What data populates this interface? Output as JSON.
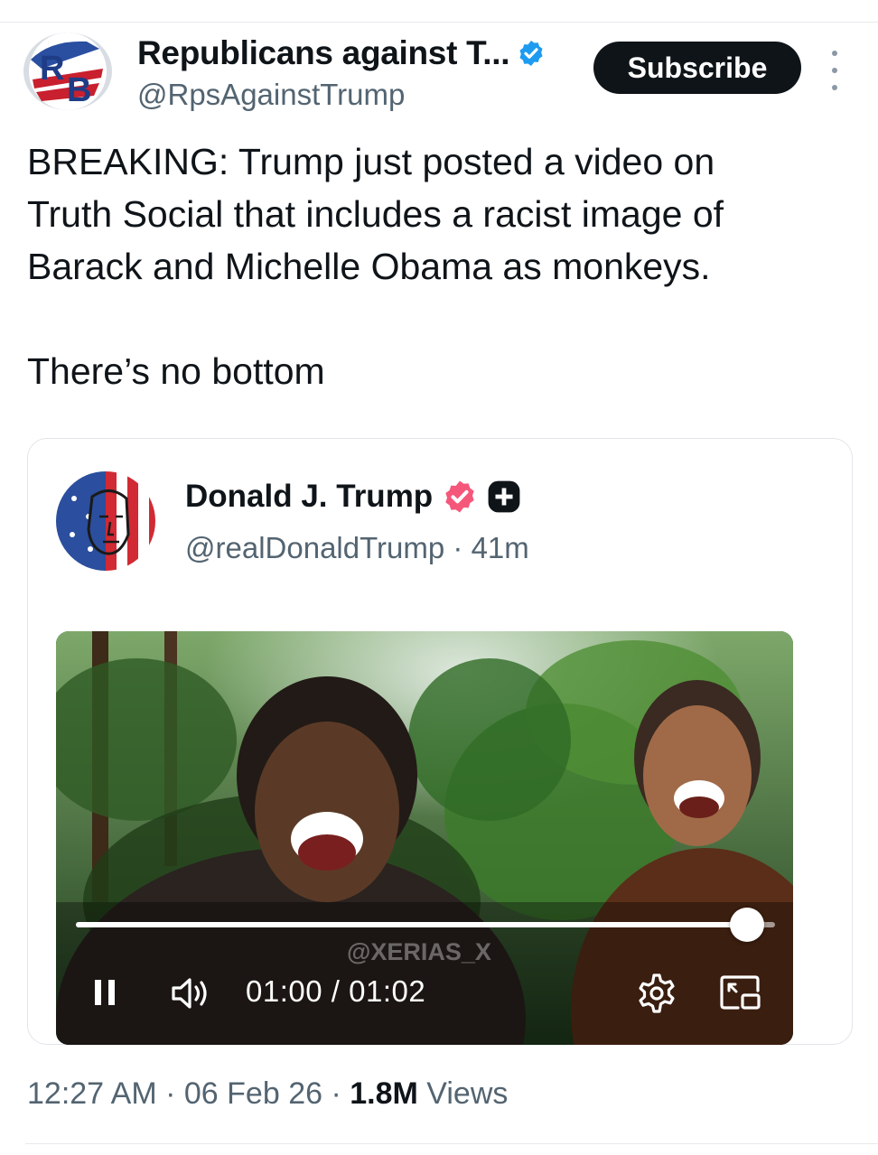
{
  "tweet": {
    "author_name": "Republicans against T...",
    "author_handle": "@RpsAgainstTrump",
    "avatar_text": "RB",
    "subscribe_label": "Subscribe",
    "text_lines": [
      "BREAKING: Trump just posted a video on",
      "Truth Social that includes a racist image of",
      "Barack and Michelle Obama as monkeys."
    ],
    "text_tail": "There’s no bottom",
    "time": "12:27 AM",
    "date": "06 Feb 26",
    "views_count": "1.8M",
    "views_label": "Views",
    "separator": "·"
  },
  "quote": {
    "author_name": "Donald J. Trump",
    "author_handle": "@realDonaldTrump",
    "age": "41m",
    "separator": "·",
    "video": {
      "watermark": "@XERIAS_X",
      "current_time": "01:00",
      "duration": "01:02",
      "time_separator": " / ",
      "progress": 0.96
    }
  },
  "colors": {
    "verified_blue": "#1d9bf0",
    "truth_pink": "#f5577b",
    "subscribe_bg": "#0f1419",
    "muted": "#536471"
  },
  "icons": [
    "verified-badge-icon",
    "truth-verified-badge-icon",
    "plus-icon",
    "more-icon",
    "pause-icon",
    "volume-icon",
    "settings-gear-icon",
    "picture-in-picture-icon"
  ]
}
